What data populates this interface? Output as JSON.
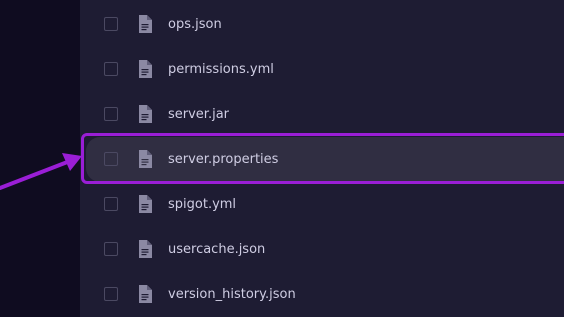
{
  "file_list": {
    "items": [
      {
        "name": "ops.json",
        "highlighted": false
      },
      {
        "name": "permissions.yml",
        "highlighted": false
      },
      {
        "name": "server.jar",
        "highlighted": false
      },
      {
        "name": "server.properties",
        "highlighted": true
      },
      {
        "name": "spigot.yml",
        "highlighted": false
      },
      {
        "name": "usercache.json",
        "highlighted": false
      },
      {
        "name": "version_history.json",
        "highlighted": false
      }
    ]
  },
  "icons": {
    "file": "file-document-icon",
    "checkbox": "checkbox-unchecked"
  },
  "colors": {
    "annotation": "#9a1ed6",
    "row_highlight": "#302e42",
    "text": "#cfcde3",
    "panel": "#1e1c33"
  }
}
